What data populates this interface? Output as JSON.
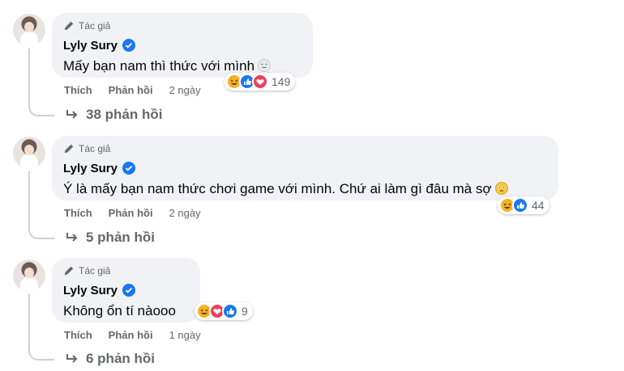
{
  "comments": [
    {
      "author_tag": "Tác giả",
      "name": "Lyly Sury",
      "text": "Mấy bạn nam thì thức với mình",
      "actions": {
        "like": "Thích",
        "reply": "Phản hồi",
        "time": "2 ngày"
      },
      "reactions": {
        "types": [
          "haha",
          "like",
          "love"
        ],
        "count": "149"
      },
      "replies": "38 phản hồi"
    },
    {
      "author_tag": "Tác giả",
      "name": "Lyly Sury",
      "text": "Ý là mấy bạn nam thức chơi game với mình. Chứ ai làm gì đâu mà sợ",
      "actions": {
        "like": "Thích",
        "reply": "Phản hồi",
        "time": "2 ngày"
      },
      "reactions": {
        "types": [
          "haha",
          "like"
        ],
        "count": "44"
      },
      "replies": "5 phản hồi"
    },
    {
      "author_tag": "Tác giả",
      "name": "Lyly Sury",
      "text": "Không ổn tí nàooo",
      "actions": {
        "like": "Thích",
        "reply": "Phản hồi",
        "time": "1 ngày"
      },
      "reactions": {
        "types": [
          "haha",
          "love",
          "like"
        ],
        "count": "9"
      },
      "replies": "6 phản hồi"
    }
  ],
  "colors": {
    "bubble": "#f0f2f5",
    "secondary_text": "#65676b",
    "like_blue": "#1877f2",
    "love_red": "#f33e58",
    "haha_yellow": "#f7b125"
  },
  "icons": [
    "pencil-icon",
    "verified-badge-icon",
    "reply-arrow-icon",
    "haha-reaction-icon",
    "like-reaction-icon",
    "love-reaction-icon",
    "emoji-icon"
  ]
}
